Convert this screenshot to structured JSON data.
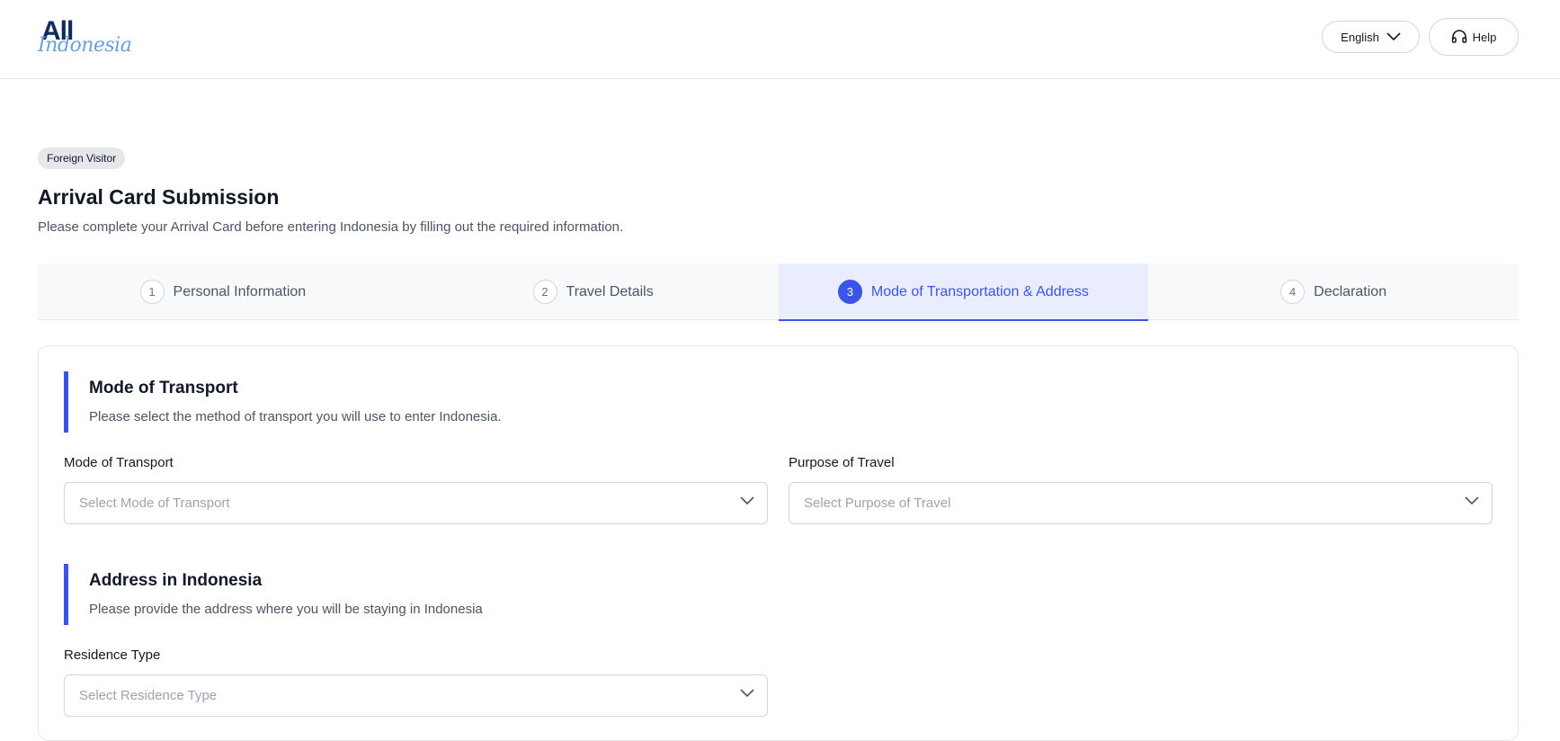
{
  "header": {
    "logo_top": "All",
    "logo_bottom": "Indonesia",
    "language": "English",
    "help": "Help"
  },
  "badge": "Foreign Visitor",
  "page": {
    "title": "Arrival Card Submission",
    "subtitle": "Please complete your Arrival Card before entering Indonesia by filling out the required information."
  },
  "steps": [
    {
      "num": "1",
      "label": "Personal Information"
    },
    {
      "num": "2",
      "label": "Travel Details"
    },
    {
      "num": "3",
      "label": "Mode of Transportation & Address"
    },
    {
      "num": "4",
      "label": "Declaration"
    }
  ],
  "transport_section": {
    "title": "Mode of Transport",
    "description": "Please select the method of transport you will use to enter Indonesia.",
    "mode_label": "Mode of Transport",
    "mode_placeholder": "Select Mode of Transport",
    "purpose_label": "Purpose of Travel",
    "purpose_placeholder": "Select Purpose of Travel"
  },
  "address_section": {
    "title": "Address in Indonesia",
    "description": "Please provide the address where you will be staying in Indonesia",
    "residence_label": "Residence Type",
    "residence_placeholder": "Select Residence Type"
  },
  "colors": {
    "accent": "#3b55e6",
    "logo_dark": "#0f2a5c",
    "logo_light": "#6aa2d8"
  }
}
